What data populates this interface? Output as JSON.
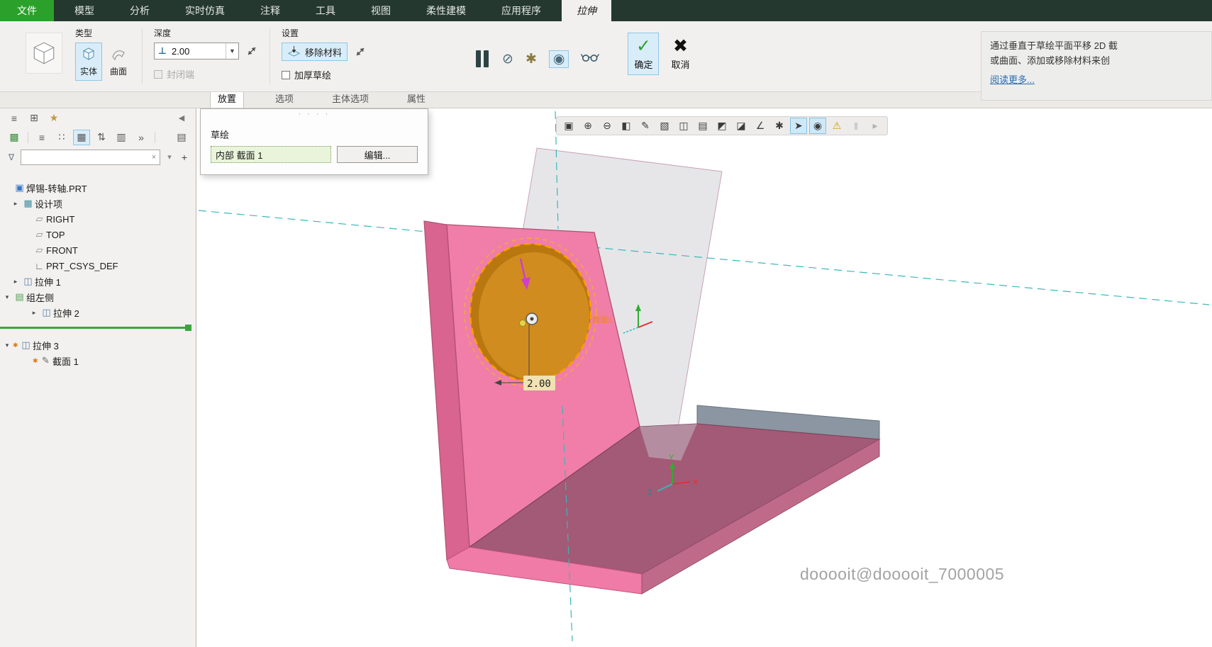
{
  "menu": {
    "items": [
      {
        "label": "文件"
      },
      {
        "label": "模型"
      },
      {
        "label": "分析"
      },
      {
        "label": "实时仿真"
      },
      {
        "label": "注释"
      },
      {
        "label": "工具"
      },
      {
        "label": "视图"
      },
      {
        "label": "柔性建模"
      },
      {
        "label": "应用程序"
      },
      {
        "label": "拉伸"
      }
    ]
  },
  "ribbon": {
    "type_group": {
      "label": "类型",
      "solid": "实体",
      "surface": "曲面"
    },
    "depth_group": {
      "label": "深度",
      "value": "2.00",
      "dropdown_arrow": "▼",
      "closed_end": "封闭端"
    },
    "depth_icon": "⊥",
    "settings_group": {
      "label": "设置",
      "remove_material": "移除材料",
      "thicken_sketch": "加厚草绘"
    },
    "preview_icons": {
      "no_preview": "⊘",
      "verify": "✱",
      "preview": "◉"
    },
    "actions": {
      "ok": "确定",
      "cancel": "取消",
      "ok_check": "✓",
      "cancel_x": "✖"
    },
    "help": {
      "line1": "通过垂直于草绘平面平移 2D 截",
      "line2": "或曲面、添加或移除材料来创",
      "more_link": "阅读更多..."
    }
  },
  "tabs": {
    "placement": "放置",
    "options": "选项",
    "body_options": "主体选项",
    "properties": "属性"
  },
  "placement_panel": {
    "drag_dots": "· · · ·",
    "sketch_label": "草绘",
    "sketch_value": "内部 截面 1",
    "edit_button": "编辑..."
  },
  "sidebar": {
    "toolbar_top": [
      {
        "name": "model-tree",
        "glyph": "≡"
      },
      {
        "name": "folder-browser",
        "glyph": "⊞"
      },
      {
        "name": "favorites",
        "glyph": "★"
      },
      {
        "name": "collapse-panel",
        "glyph": "◀"
      }
    ],
    "toolbar_view": [
      {
        "name": "tree-settings",
        "glyph": "▩"
      },
      {
        "name": "list-view",
        "glyph": "≡"
      },
      {
        "name": "detail-view",
        "glyph": "∷"
      },
      {
        "name": "grid-view",
        "glyph": "▦"
      },
      {
        "name": "sort",
        "glyph": "⇅"
      },
      {
        "name": "columns",
        "glyph": "▥"
      },
      {
        "name": "more",
        "glyph": "»"
      },
      {
        "name": "open-sheet",
        "glyph": "▤"
      }
    ],
    "search": {
      "filter_icon": "∇",
      "value": "",
      "clear_icon": "×",
      "dropdown_icon": "▾",
      "add_icon": "+"
    },
    "tree": [
      {
        "exp": "",
        "glyph": "▣",
        "mark": "",
        "label": "焊锡-转轴.PRT"
      },
      {
        "exp": "▸",
        "glyph": "▦",
        "mark": "",
        "label": "设计项"
      },
      {
        "exp": "",
        "glyph": "▱",
        "mark": "",
        "label": "RIGHT"
      },
      {
        "exp": "",
        "glyph": "▱",
        "mark": "",
        "label": "TOP"
      },
      {
        "exp": "",
        "glyph": "▱",
        "mark": "",
        "label": "FRONT"
      },
      {
        "exp": "",
        "glyph": "∟",
        "mark": "",
        "label": "PRT_CSYS_DEF"
      },
      {
        "exp": "▸",
        "glyph": "◫",
        "mark": "",
        "label": "拉伸 1"
      },
      {
        "exp": "▾",
        "glyph": "▤",
        "mark": "",
        "label": "组左侧"
      },
      {
        "exp": "▸",
        "glyph": "◫",
        "mark": "",
        "label": "拉伸 2"
      },
      {
        "exp": "▾",
        "glyph": "◫",
        "mark": "✱",
        "label": "拉伸 3"
      },
      {
        "exp": "",
        "glyph": "✎",
        "mark": "✱",
        "label": "截面 1"
      }
    ]
  },
  "viewport": {
    "toolbar": [
      {
        "name": "zoom-region",
        "glyph": "▣"
      },
      {
        "name": "zoom-in",
        "glyph": "⊕"
      },
      {
        "name": "zoom-out",
        "glyph": "⊖"
      },
      {
        "name": "repaint",
        "glyph": "◧"
      },
      {
        "name": "sketch-pen",
        "glyph": "✎"
      },
      {
        "name": "display-style",
        "glyph": "▧"
      },
      {
        "name": "section-view",
        "glyph": "◫"
      },
      {
        "name": "capture",
        "glyph": "▤"
      },
      {
        "name": "scene",
        "glyph": "◩"
      },
      {
        "name": "datum-display",
        "glyph": "◪"
      },
      {
        "name": "annotations",
        "glyph": "∠"
      },
      {
        "name": "enhance",
        "glyph": "✱"
      },
      {
        "name": "select-mode",
        "glyph": "➤"
      },
      {
        "name": "snap-mode",
        "glyph": "◉"
      },
      {
        "name": "warning",
        "glyph": "⚠"
      },
      {
        "name": "pause",
        "glyph": "‖"
      },
      {
        "name": "step",
        "glyph": "▸"
      }
    ],
    "dimension": "2.00",
    "sketch_tag": "截面1",
    "axes": {
      "y": "Y",
      "z": "Z",
      "x": "X"
    },
    "watermark": "dooooit@dooooit_7000005"
  }
}
